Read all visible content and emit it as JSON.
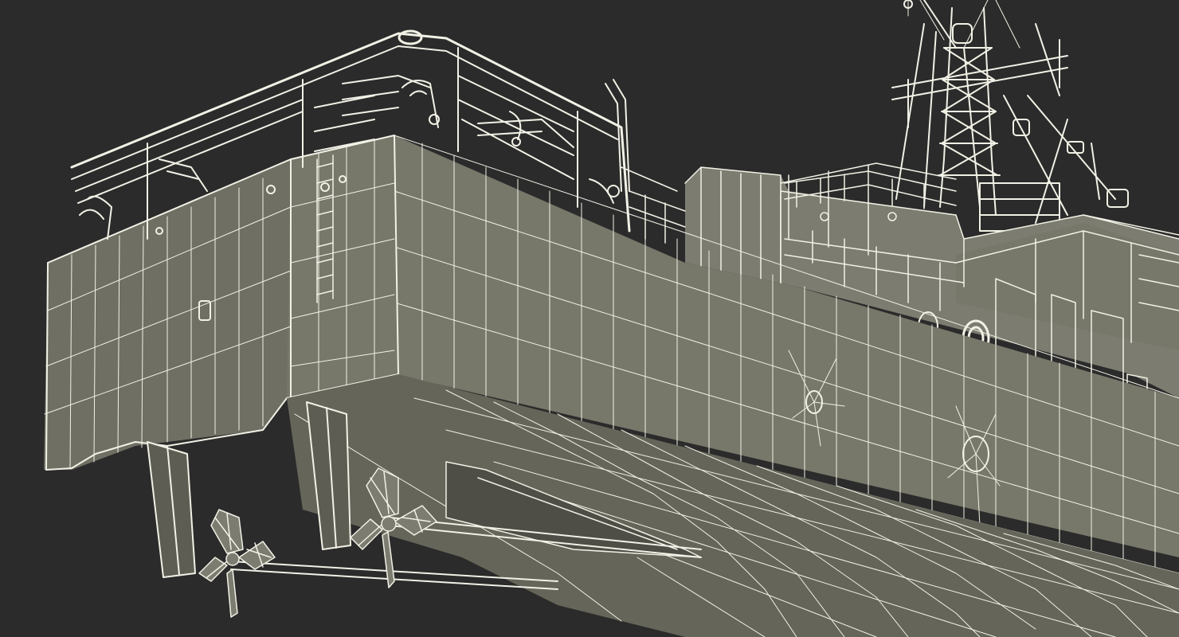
{
  "scene": {
    "subject": "ship-stern-wireframe-render",
    "colors": {
      "background": "#2b2b2b",
      "hull": "#77776a",
      "wire": "#f2f1e6"
    }
  }
}
